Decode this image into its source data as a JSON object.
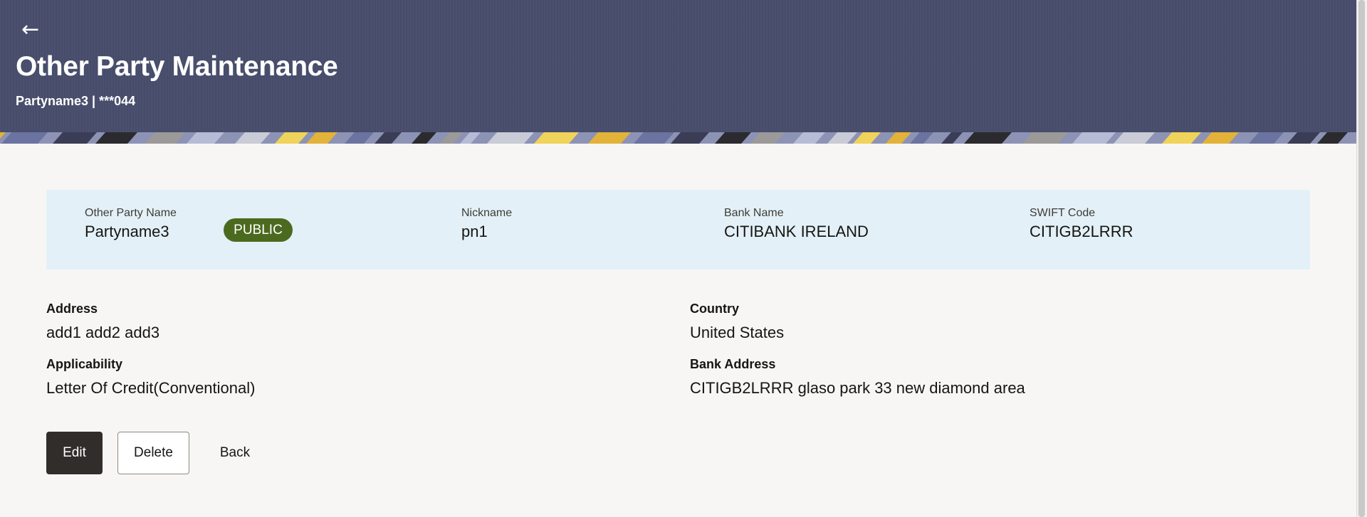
{
  "header": {
    "back_icon": "arrow-left-icon",
    "title": "Other Party Maintenance",
    "subtitle": "Partyname3 | ***044",
    "background_color": "#474d6b"
  },
  "summary": {
    "party_name_label": "Other Party Name",
    "party_name_value": "Partyname3",
    "badge": "PUBLIC",
    "nickname_label": "Nickname",
    "nickname_value": "pn1",
    "bank_name_label": "Bank Name",
    "bank_name_value": "CITIBANK IRELAND",
    "swift_label": "SWIFT Code",
    "swift_value": "CITIGB2LRRR",
    "background_color": "#e3f0f7",
    "badge_color": "#4c6a1f"
  },
  "details": {
    "address_label": "Address",
    "address_value": "add1 add2 add3",
    "country_label": "Country",
    "country_value": "United States",
    "applicability_label": "Applicability",
    "applicability_value": "Letter Of Credit(Conventional)",
    "bank_address_label": "Bank Address",
    "bank_address_value": "CITIGB2LRRR glaso park 33 new diamond area"
  },
  "actions": {
    "edit_label": "Edit",
    "delete_label": "Delete",
    "back_label": "Back"
  }
}
